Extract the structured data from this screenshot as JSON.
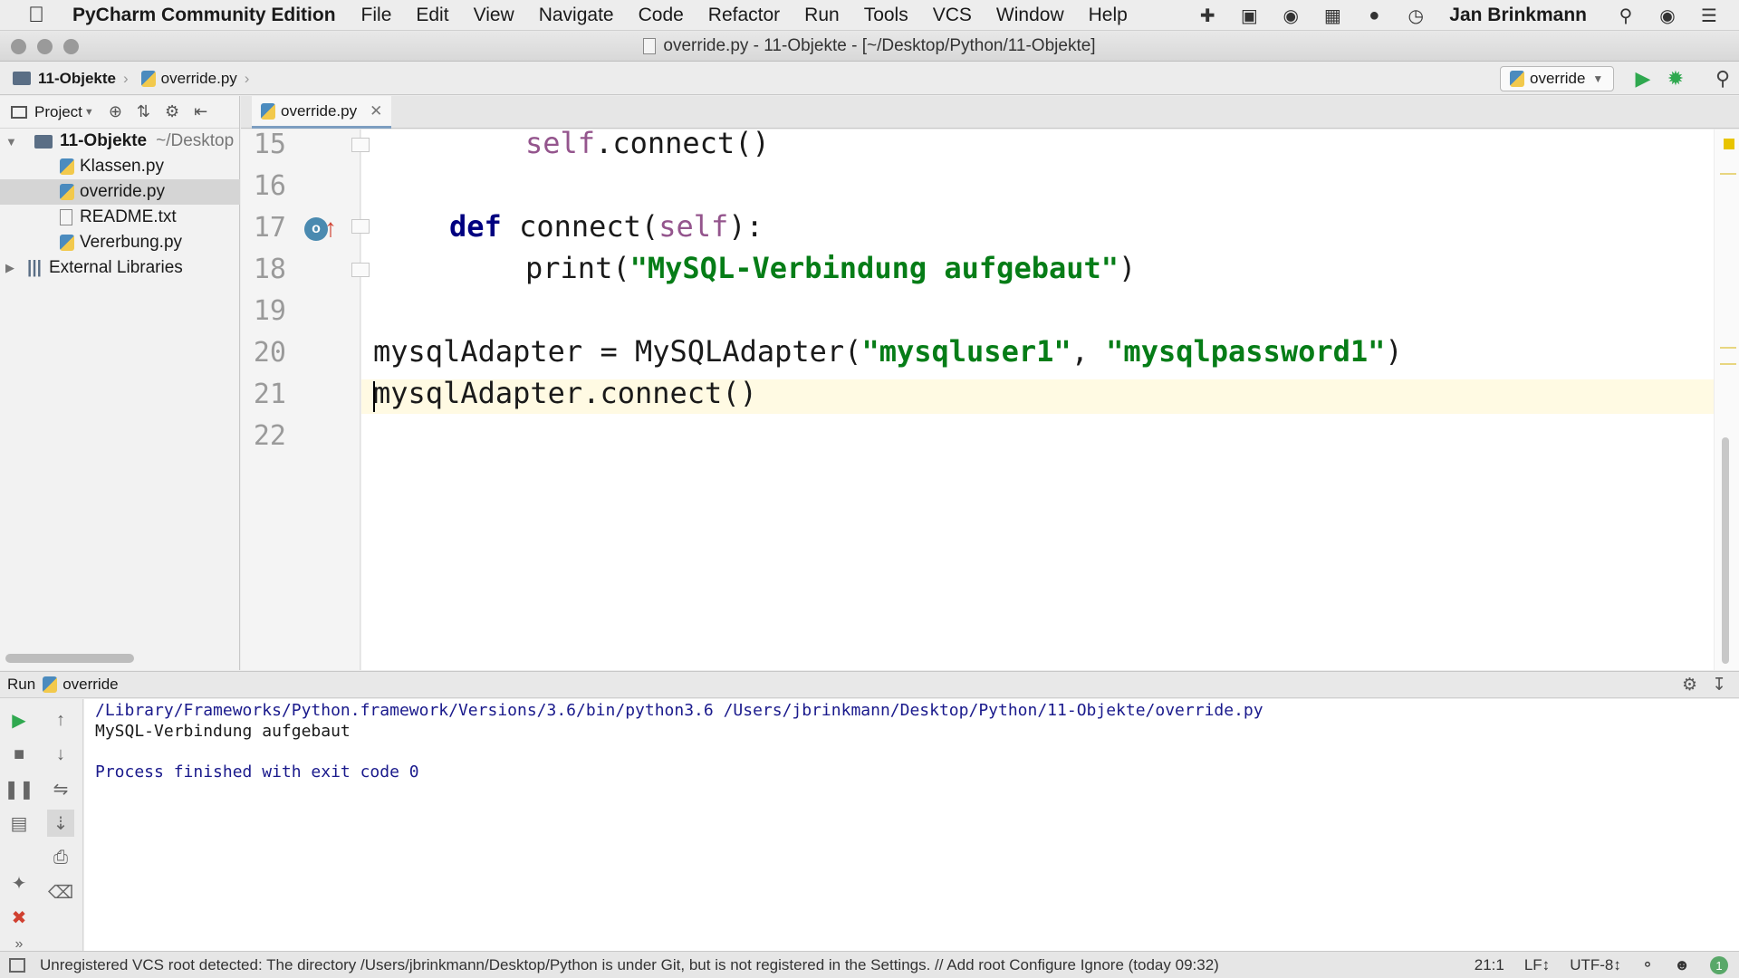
{
  "menubar": {
    "app_name": "PyCharm Community Edition",
    "items": [
      "File",
      "Edit",
      "View",
      "Navigate",
      "Code",
      "Refactor",
      "Run",
      "Tools",
      "VCS",
      "Window",
      "Help"
    ],
    "user": "Jan Brinkmann"
  },
  "window": {
    "title": "override.py - 11-Objekte - [~/Desktop/Python/11-Objekte]"
  },
  "navbar": {
    "project": "11-Objekte",
    "file": "override.py",
    "run_config": "override"
  },
  "project_panel": {
    "title": "Project",
    "root": "11-Objekte",
    "root_path": "~/Desktop",
    "files": [
      "Klassen.py",
      "override.py",
      "README.txt",
      "Vererbung.py"
    ],
    "selected_file": "override.py",
    "external": "External Libraries"
  },
  "editor": {
    "tab": "override.py",
    "line_numbers": [
      "15",
      "16",
      "17",
      "18",
      "19",
      "20",
      "21",
      "22"
    ],
    "code": {
      "l15_self": "self",
      "l15_rest": ".connect()",
      "l17_def": "def",
      "l17_name": " connect(",
      "l17_self": "self",
      "l17_end": "):",
      "l18_print": "print(",
      "l18_str": "\"MySQL-Verbindung aufgebaut\"",
      "l18_end": ")",
      "l20_start": "mysqlAdapter = MySQLAdapter(",
      "l20_str1": "\"mysqluser1\"",
      "l20_comma": ", ",
      "l20_str2": "\"mysqlpassword1\"",
      "l20_end": ")",
      "l21": "mysqlAdapter.connect()"
    },
    "cursor_line": "21"
  },
  "run_panel": {
    "label": "Run",
    "config": "override",
    "output": [
      "/Library/Frameworks/Python.framework/Versions/3.6/bin/python3.6 /Users/jbrinkmann/Desktop/Python/11-Objekte/override.py",
      "MySQL-Verbindung aufgebaut",
      "",
      "Process finished with exit code 0"
    ]
  },
  "statusbar": {
    "message": "Unregistered VCS root detected: The directory /Users/jbrinkmann/Desktop/Python is under Git, but is not registered in the Settings. // Add root  Configure  Ignore (today 09:32)",
    "position": "21:1",
    "line_sep": "LF↕",
    "encoding": "UTF-8↕",
    "notifications": "1"
  },
  "colors": {
    "keyword": "#000080",
    "string": "#067d17",
    "self": "#94558d",
    "run_green": "#2fa84f"
  }
}
